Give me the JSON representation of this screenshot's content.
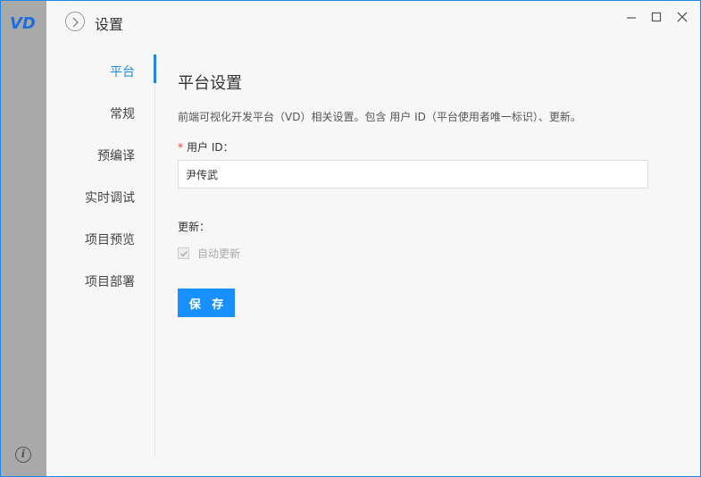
{
  "app": {
    "logo_text": "VD"
  },
  "header": {
    "title": "设置"
  },
  "nav": {
    "items": [
      {
        "label": "平台",
        "active": true
      },
      {
        "label": "常规",
        "active": false
      },
      {
        "label": "预编译",
        "active": false
      },
      {
        "label": "实时调试",
        "active": false
      },
      {
        "label": "项目预览",
        "active": false
      },
      {
        "label": "项目部署",
        "active": false
      }
    ]
  },
  "panel": {
    "title": "平台设置",
    "description": "前端可视化开发平台（VD）相关设置。包含 用户 ID（平台使用者唯一标识）、更新。",
    "user_id": {
      "required_mark": "*",
      "label": "用户 ID：",
      "value": "尹传武"
    },
    "update": {
      "section_label": "更新：",
      "auto_update_label": "自动更新",
      "checked": true,
      "disabled": true
    },
    "save_label": "保 存"
  },
  "colors": {
    "accent": "#1890ff",
    "rail": "#a9a9a9",
    "background": "#f7f7f7",
    "required": "#e53935"
  }
}
